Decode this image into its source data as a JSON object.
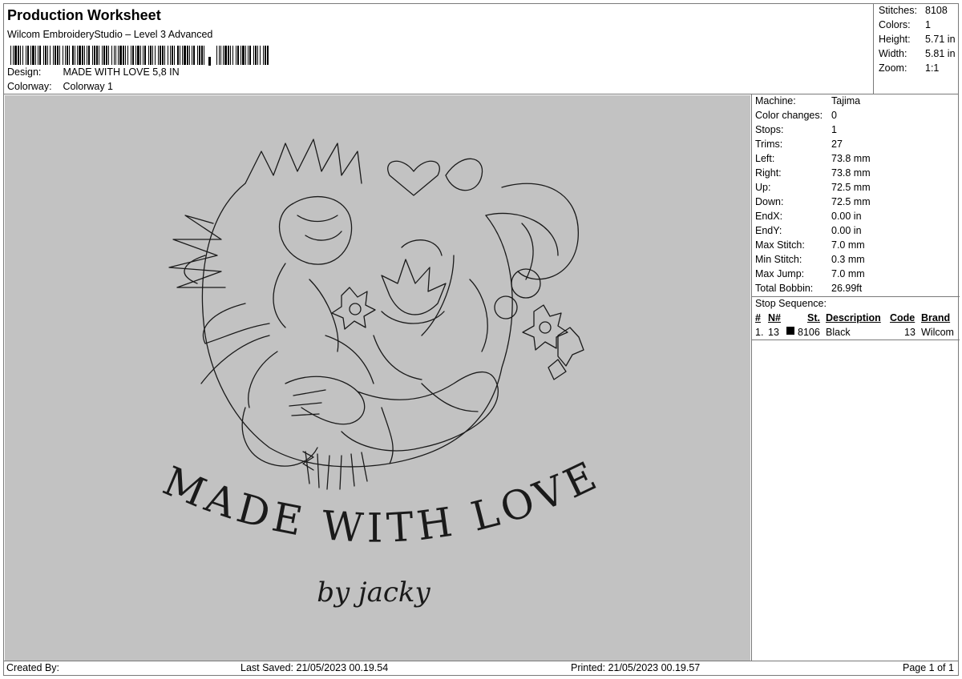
{
  "header": {
    "title": "Production Worksheet",
    "subtitle": "Wilcom EmbroideryStudio – Level 3 Advanced",
    "design_label": "Design:",
    "design_value": "MADE WITH LOVE 5,8 IN",
    "colorway_label": "Colorway:",
    "colorway_value": "Colorway 1"
  },
  "summary": [
    {
      "label": "Stitches:",
      "value": "8108"
    },
    {
      "label": "Colors:",
      "value": "1"
    },
    {
      "label": "Height:",
      "value": "5.71 in"
    },
    {
      "label": "Width:",
      "value": "5.81 in"
    },
    {
      "label": "Zoom:",
      "value": "1:1"
    }
  ],
  "specs": [
    {
      "label": "Machine:",
      "value": "Tajima"
    },
    {
      "label": "Color changes:",
      "value": "0"
    },
    {
      "label": "Stops:",
      "value": "1"
    },
    {
      "label": "Trims:",
      "value": "27"
    },
    {
      "label": "Left:",
      "value": "73.8 mm"
    },
    {
      "label": "Right:",
      "value": "73.8 mm"
    },
    {
      "label": "Up:",
      "value": "72.5 mm"
    },
    {
      "label": "Down:",
      "value": "72.5 mm"
    },
    {
      "label": "EndX:",
      "value": "0.00 in"
    },
    {
      "label": "EndY:",
      "value": "0.00 in"
    },
    {
      "label": "Max Stitch:",
      "value": "7.0 mm"
    },
    {
      "label": "Min Stitch:",
      "value": "0.3 mm"
    },
    {
      "label": "Max Jump:",
      "value": "7.0 mm"
    },
    {
      "label": "Total Bobbin:",
      "value": "26.99ft"
    }
  ],
  "stop_sequence": {
    "title": "Stop Sequence:",
    "columns": [
      "#",
      "N#",
      "St.",
      "Description",
      "Code",
      "Brand"
    ],
    "rows": [
      {
        "index": "1.",
        "needle": "13",
        "swatch_color": "#000000",
        "stitches": "8106",
        "description": "Black",
        "code": "13",
        "brand": "Wilcom"
      }
    ]
  },
  "design_preview": {
    "text_main": "MADE WITH LOVE",
    "text_sub": "by jacky",
    "thread_color": "#1a1a1a",
    "background": "#c2c2c2"
  },
  "footer": {
    "created_by": "Created By:",
    "last_saved": "Last Saved: 21/05/2023 00.19.54",
    "printed": "Printed: 21/05/2023 00.19.57",
    "page": "Page 1 of 1"
  }
}
